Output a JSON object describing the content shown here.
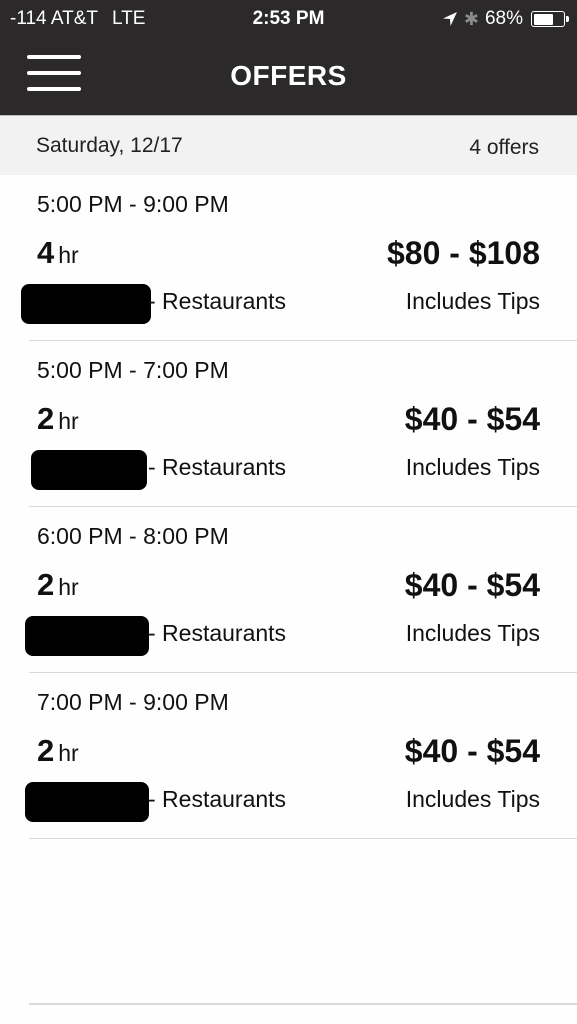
{
  "status_bar": {
    "signal": "-114 AT&T",
    "network": "LTE",
    "time": "2:53 PM",
    "battery_percent_label": "68%",
    "battery_level": 0.68,
    "icons": [
      "location-arrow-icon",
      "bluetooth-icon",
      "battery-icon"
    ]
  },
  "nav": {
    "title": "OFFERS",
    "menu_icon": "hamburger-menu-icon"
  },
  "date_header": {
    "date": "Saturday, 12/17",
    "count": "4 offers"
  },
  "offers": [
    {
      "time": "5:00 PM - 9:00 PM",
      "duration": "4",
      "unit": "hr",
      "pay": "$80 - $108",
      "category": "- Restaurants",
      "tips": "Includes Tips"
    },
    {
      "time": "5:00 PM - 7:00 PM",
      "duration": "2",
      "unit": "hr",
      "pay": "$40 - $54",
      "category": "- Restaurants",
      "tips": "Includes Tips"
    },
    {
      "time": "6:00 PM - 8:00 PM",
      "duration": "2",
      "unit": "hr",
      "pay": "$40 - $54",
      "category": "- Restaurants",
      "tips": "Includes Tips"
    },
    {
      "time": "7:00 PM - 9:00 PM",
      "duration": "2",
      "unit": "hr",
      "pay": "$40 - $54",
      "category": "- Restaurants",
      "tips": "Includes Tips"
    }
  ],
  "colors": {
    "header_bg": "#2b292a",
    "date_header_bg": "#f2f2f2",
    "divider": "#dadada"
  }
}
